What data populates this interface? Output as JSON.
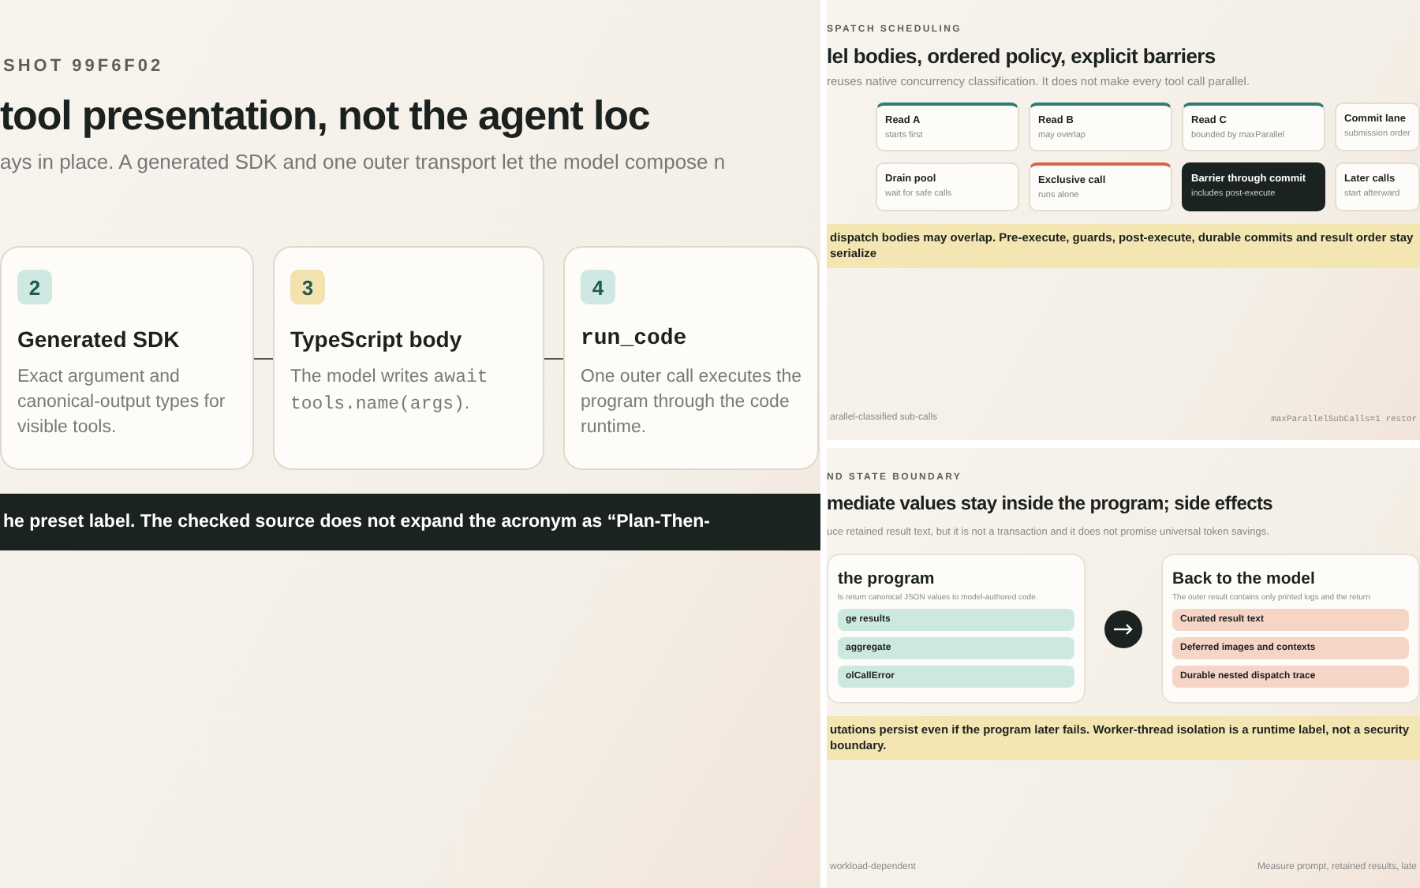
{
  "overview": {
    "eyebrow": "SHOT 99F6F02",
    "title": "tool presentation, not the agent loc",
    "subtitle": "ays in place. A generated SDK and one outer transport let the model compose n",
    "steps": [
      {
        "number": "2",
        "color": "#cfe8e2",
        "title": "Generated SDK",
        "kind": "text",
        "description": [
          {
            "text": "Exact argument and canonical-output types for visible tools.",
            "kind": "text"
          }
        ]
      },
      {
        "number": "3",
        "color": "#f1e2b0",
        "title": "TypeScript body",
        "kind": "text",
        "description": [
          {
            "text": "The model writes ",
            "kind": "text"
          },
          {
            "text": "await tools.name(args)",
            "kind": "code"
          },
          {
            "text": ".",
            "kind": "text"
          }
        ]
      },
      {
        "number": "4",
        "color": "#cfe8e2",
        "title": "run_code",
        "kind": "code",
        "description": [
          {
            "text": "One outer call executes the program through the code runtime.",
            "kind": "text"
          }
        ]
      }
    ],
    "banner": "he preset label. The checked source does not expand the acronym as  “Plan-Then-"
  },
  "scheduling": {
    "eyebrow": "SPATCH SCHEDULING",
    "title": "lel bodies, ordered policy, explicit barriers",
    "subtitle": "reuses native concurrency classification. It does not make every tool call parallel.",
    "lanes": [
      {
        "kind": "read",
        "title": "Read A",
        "note": "starts first"
      },
      {
        "kind": "read",
        "title": "Read B",
        "note": "may overlap"
      },
      {
        "kind": "read",
        "title": "Read C",
        "note": "bounded by maxParallel"
      },
      {
        "kind": "plain",
        "title": "Commit lane",
        "note": "submission order"
      },
      {
        "kind": "plain",
        "title": "Drain pool",
        "note": "wait for safe calls"
      },
      {
        "kind": "exclusive",
        "title": "Exclusive call",
        "note": "runs alone"
      },
      {
        "kind": "barrier",
        "title": "Barrier through commit",
        "note": "includes post-execute"
      },
      {
        "kind": "plain",
        "title": "Later calls",
        "note": "start afterward"
      }
    ],
    "banner": "dispatch bodies may overlap. Pre-execute, guards, post-execute, durable commits and result order stay serialize",
    "footer_left": "arallel-classified sub-calls",
    "footer_right": "maxParallelSubCalls=1 restor"
  },
  "boundary": {
    "eyebrow": "ND STATE BOUNDARY",
    "title": "mediate values stay inside the program; side effects",
    "subtitle": "uce retained result text, but it is not a transaction and it does not promise universal token savings.",
    "inside": {
      "title": "the program",
      "note": "ls return canonical JSON values to model-authored code.",
      "items": [
        "ge results",
        "aggregate",
        "olCallError"
      ]
    },
    "outside": {
      "title": "Back to the model",
      "note": "The outer result contains only printed logs and the return",
      "items": [
        "Curated result text",
        "Deferred images and contexts",
        "Durable nested dispatch trace"
      ]
    },
    "banner": "utations persist even if the program later fails. Worker-thread isolation is a runtime label, not a security boundary.",
    "footer_left": "workload-dependent",
    "footer_right": "Measure prompt, retained results, late"
  }
}
